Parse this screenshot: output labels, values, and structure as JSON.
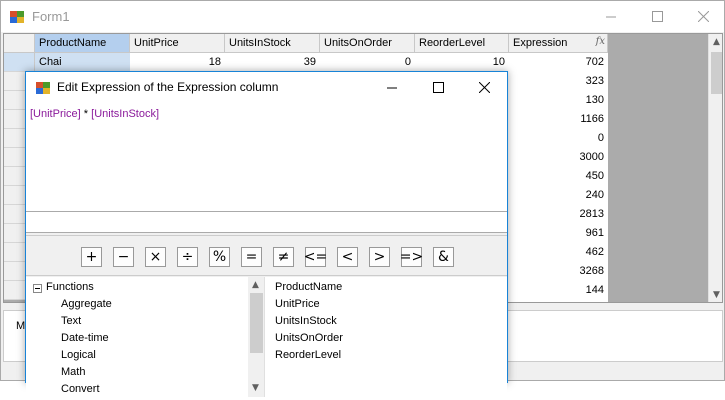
{
  "window": {
    "title": "Form1"
  },
  "grid": {
    "columns": [
      "ProductName",
      "UnitPrice",
      "UnitsInStock",
      "UnitsOnOrder",
      "ReorderLevel",
      "Expression"
    ],
    "expression_icon": "fx",
    "first_row": {
      "ProductName": "Chai",
      "UnitPrice": "18",
      "UnitsInStock": "39",
      "UnitsOnOrder": "0",
      "ReorderLevel": "10"
    },
    "expression_values": [
      "702",
      "323",
      "130",
      "1166",
      "0",
      "3000",
      "450",
      "240",
      "2813",
      "961",
      "462",
      "3268",
      "144"
    ]
  },
  "bottom": {
    "label": "M"
  },
  "dialog": {
    "title": "Edit Expression of the Expression column",
    "expression_parts": [
      "[UnitPrice]",
      " * ",
      "[UnitsInStock]"
    ],
    "operators": [
      "+",
      "−",
      "×",
      "÷",
      "%",
      "=",
      "≠",
      "<=",
      "<",
      ">",
      "=>",
      "&"
    ],
    "tree": {
      "root": "Functions",
      "children": [
        "Aggregate",
        "Text",
        "Date-time",
        "Logical",
        "Math",
        "Convert"
      ]
    },
    "fields": [
      "ProductName",
      "UnitPrice",
      "UnitsInStock",
      "UnitsOnOrder",
      "ReorderLevel"
    ]
  }
}
